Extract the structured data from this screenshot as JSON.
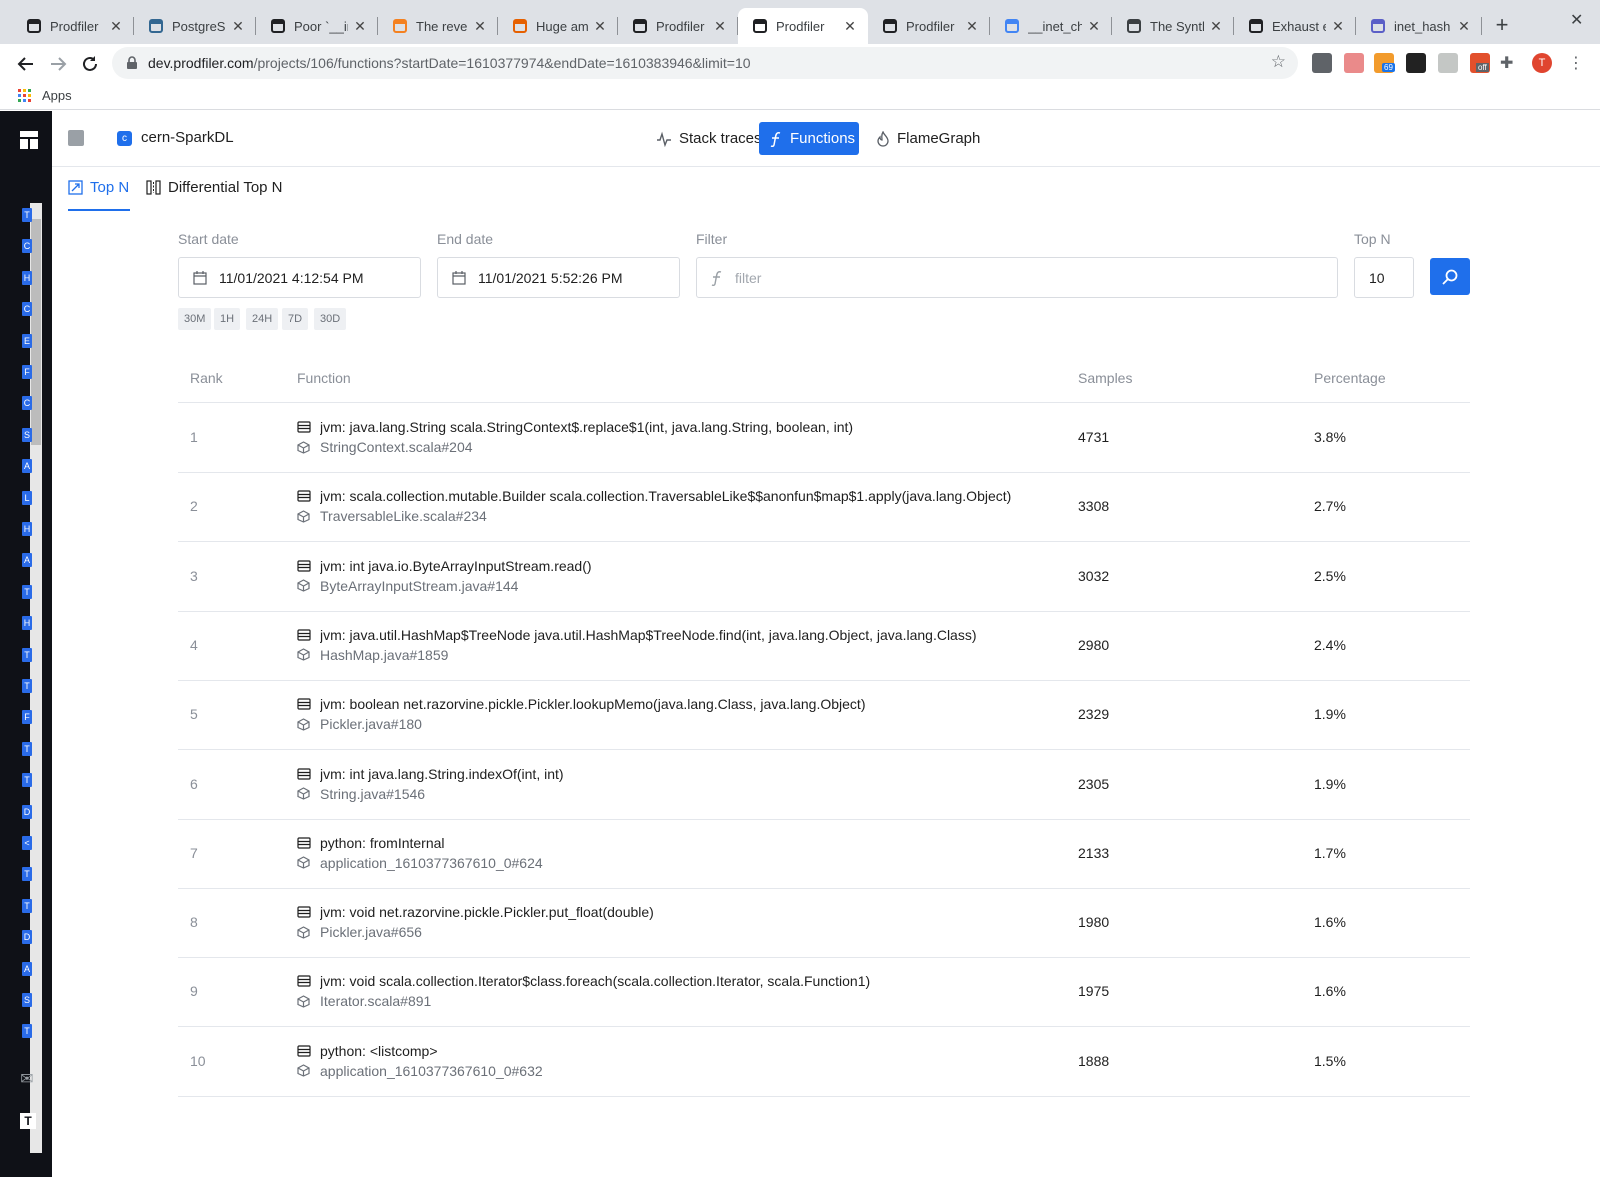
{
  "browser": {
    "tabs": [
      {
        "title": "Prodfiler",
        "icon": "prodfiler-icon"
      },
      {
        "title": "PostgreSQL",
        "icon": "postgres-icon"
      },
      {
        "title": "Poor `__in",
        "icon": "github-icon"
      },
      {
        "title": "The reven",
        "icon": "cloudflare-icon"
      },
      {
        "title": "Huge amo",
        "icon": "firefox-icon"
      },
      {
        "title": "Prodfiler",
        "icon": "prodfiler-icon"
      },
      {
        "title": "Prodfiler",
        "icon": "prodfiler-icon"
      },
      {
        "title": "Prodfiler",
        "icon": "prodfiler-icon"
      },
      {
        "title": "__inet_ch",
        "icon": "google-icon"
      },
      {
        "title": "The Synth",
        "icon": "globe-icon"
      },
      {
        "title": "Exhaust e",
        "icon": "github-icon"
      },
      {
        "title": "inet_hash",
        "icon": "doc-icon"
      }
    ],
    "active_tab_index": 6,
    "url_host": "dev.prodfiler.com",
    "url_path": "/projects/106/functions?startDate=1610377974&endDate=1610383946&limit=10",
    "bookmarks_apps_label": "Apps",
    "profile_initial": "T",
    "ext_badge": "69",
    "ext_off_label": "off"
  },
  "rail": {
    "letters": [
      "T",
      "C",
      "H",
      "C",
      "E",
      "F",
      "C",
      "S",
      "A",
      "L",
      "H",
      "A",
      "T",
      "H",
      "T",
      "T",
      "F",
      "T",
      "T",
      "D",
      "<",
      "T",
      "T",
      "D",
      "A",
      "S",
      "T"
    ],
    "bottom_initial": "T"
  },
  "header": {
    "project_badge": "c",
    "project_name": "cern-SparkDL",
    "nav": [
      {
        "label": "Stack traces",
        "icon": "pulse-icon"
      },
      {
        "label": "Functions",
        "icon": "function-icon"
      },
      {
        "label": "FlameGraph",
        "icon": "flame-icon"
      }
    ],
    "active_nav": "Functions"
  },
  "subtabs": {
    "items": [
      "Top N",
      "Differential Top N"
    ],
    "active": "Top N"
  },
  "filters": {
    "start_label": "Start date",
    "start_value": "11/01/2021 4:12:54 PM",
    "end_label": "End date",
    "end_value": "11/01/2021 5:52:26 PM",
    "filter_label": "Filter",
    "filter_placeholder": "filter",
    "filter_value": "",
    "topn_label": "Top N",
    "topn_value": "10",
    "quick_ranges": [
      "30M",
      "1H",
      "24H",
      "7D",
      "30D"
    ]
  },
  "table": {
    "headers": {
      "rank": "Rank",
      "function": "Function",
      "samples": "Samples",
      "percentage": "Percentage"
    },
    "rows": [
      {
        "rank": "1",
        "function": "jvm: java.lang.String scala.StringContext$.replace$1(int, java.lang.String, boolean, int)",
        "location": "StringContext.scala#204",
        "samples": "4731",
        "percentage": "3.8%"
      },
      {
        "rank": "2",
        "function": "jvm: scala.collection.mutable.Builder scala.collection.TraversableLike$$anonfun$map$1.apply(java.lang.Object)",
        "location": "TraversableLike.scala#234",
        "samples": "3308",
        "percentage": "2.7%"
      },
      {
        "rank": "3",
        "function": "jvm: int java.io.ByteArrayInputStream.read()",
        "location": "ByteArrayInputStream.java#144",
        "samples": "3032",
        "percentage": "2.5%"
      },
      {
        "rank": "4",
        "function": "jvm: java.util.HashMap$TreeNode java.util.HashMap$TreeNode.find(int, java.lang.Object, java.lang.Class)",
        "location": "HashMap.java#1859",
        "samples": "2980",
        "percentage": "2.4%"
      },
      {
        "rank": "5",
        "function": "jvm: boolean net.razorvine.pickle.Pickler.lookupMemo(java.lang.Class, java.lang.Object)",
        "location": "Pickler.java#180",
        "samples": "2329",
        "percentage": "1.9%"
      },
      {
        "rank": "6",
        "function": "jvm: int java.lang.String.indexOf(int, int)",
        "location": "String.java#1546",
        "samples": "2305",
        "percentage": "1.9%"
      },
      {
        "rank": "7",
        "function": "python: fromInternal",
        "location": "application_1610377367610_0#624",
        "samples": "2133",
        "percentage": "1.7%"
      },
      {
        "rank": "8",
        "function": "jvm: void net.razorvine.pickle.Pickler.put_float(double)",
        "location": "Pickler.java#656",
        "samples": "1980",
        "percentage": "1.6%"
      },
      {
        "rank": "9",
        "function": "jvm: void scala.collection.Iterator$class.foreach(scala.collection.Iterator, scala.Function1)",
        "location": "Iterator.scala#891",
        "samples": "1975",
        "percentage": "1.6%"
      },
      {
        "rank": "10",
        "function": "python: <listcomp>",
        "location": "application_1610377367610_0#632",
        "samples": "1888",
        "percentage": "1.5%"
      }
    ]
  },
  "colors": {
    "accent": "#1f6feb",
    "rail": "#0f1117"
  }
}
